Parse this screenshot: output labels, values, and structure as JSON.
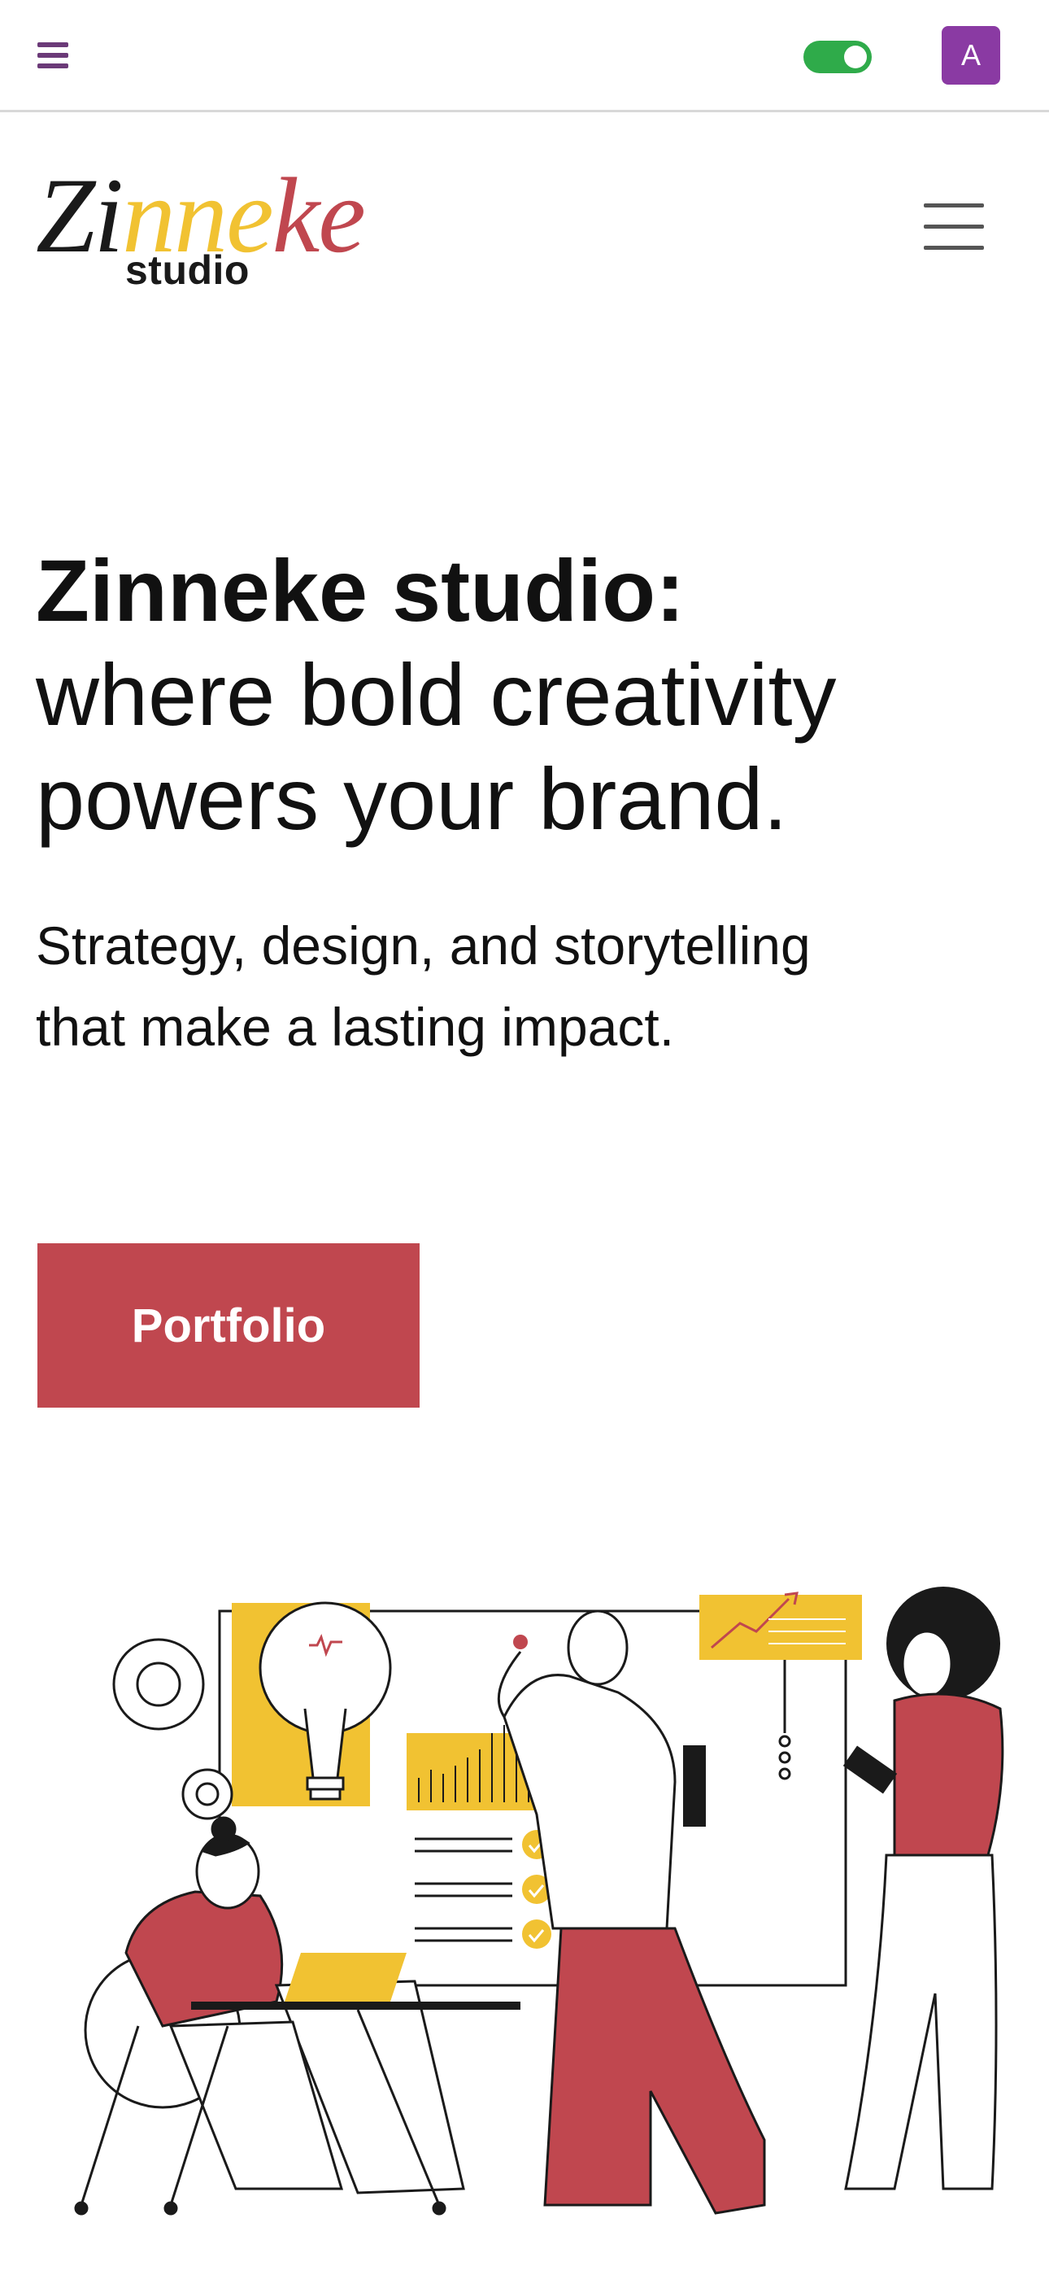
{
  "admin_bar": {
    "avatar_letter": "A",
    "toggle_state": "on",
    "colors": {
      "menu": "#6b3a78",
      "toggle": "#2fab4a",
      "avatar": "#8a3aa3"
    }
  },
  "header": {
    "logo": {
      "part1": "Zi",
      "part2": "nne",
      "part3": "ke",
      "sub": "studio"
    },
    "menu_icon": "hamburger-icon"
  },
  "hero": {
    "title_bold": "Zinneke studio:",
    "title_line2": "where bold creativity",
    "title_line3": "powers your brand.",
    "lead_line1": "Strategy, design, and storytelling",
    "lead_line2": "that make a lasting impact.",
    "cta_label": "Portfolio",
    "colors": {
      "accent": "#c0474f",
      "yellow": "#f1c232"
    }
  }
}
